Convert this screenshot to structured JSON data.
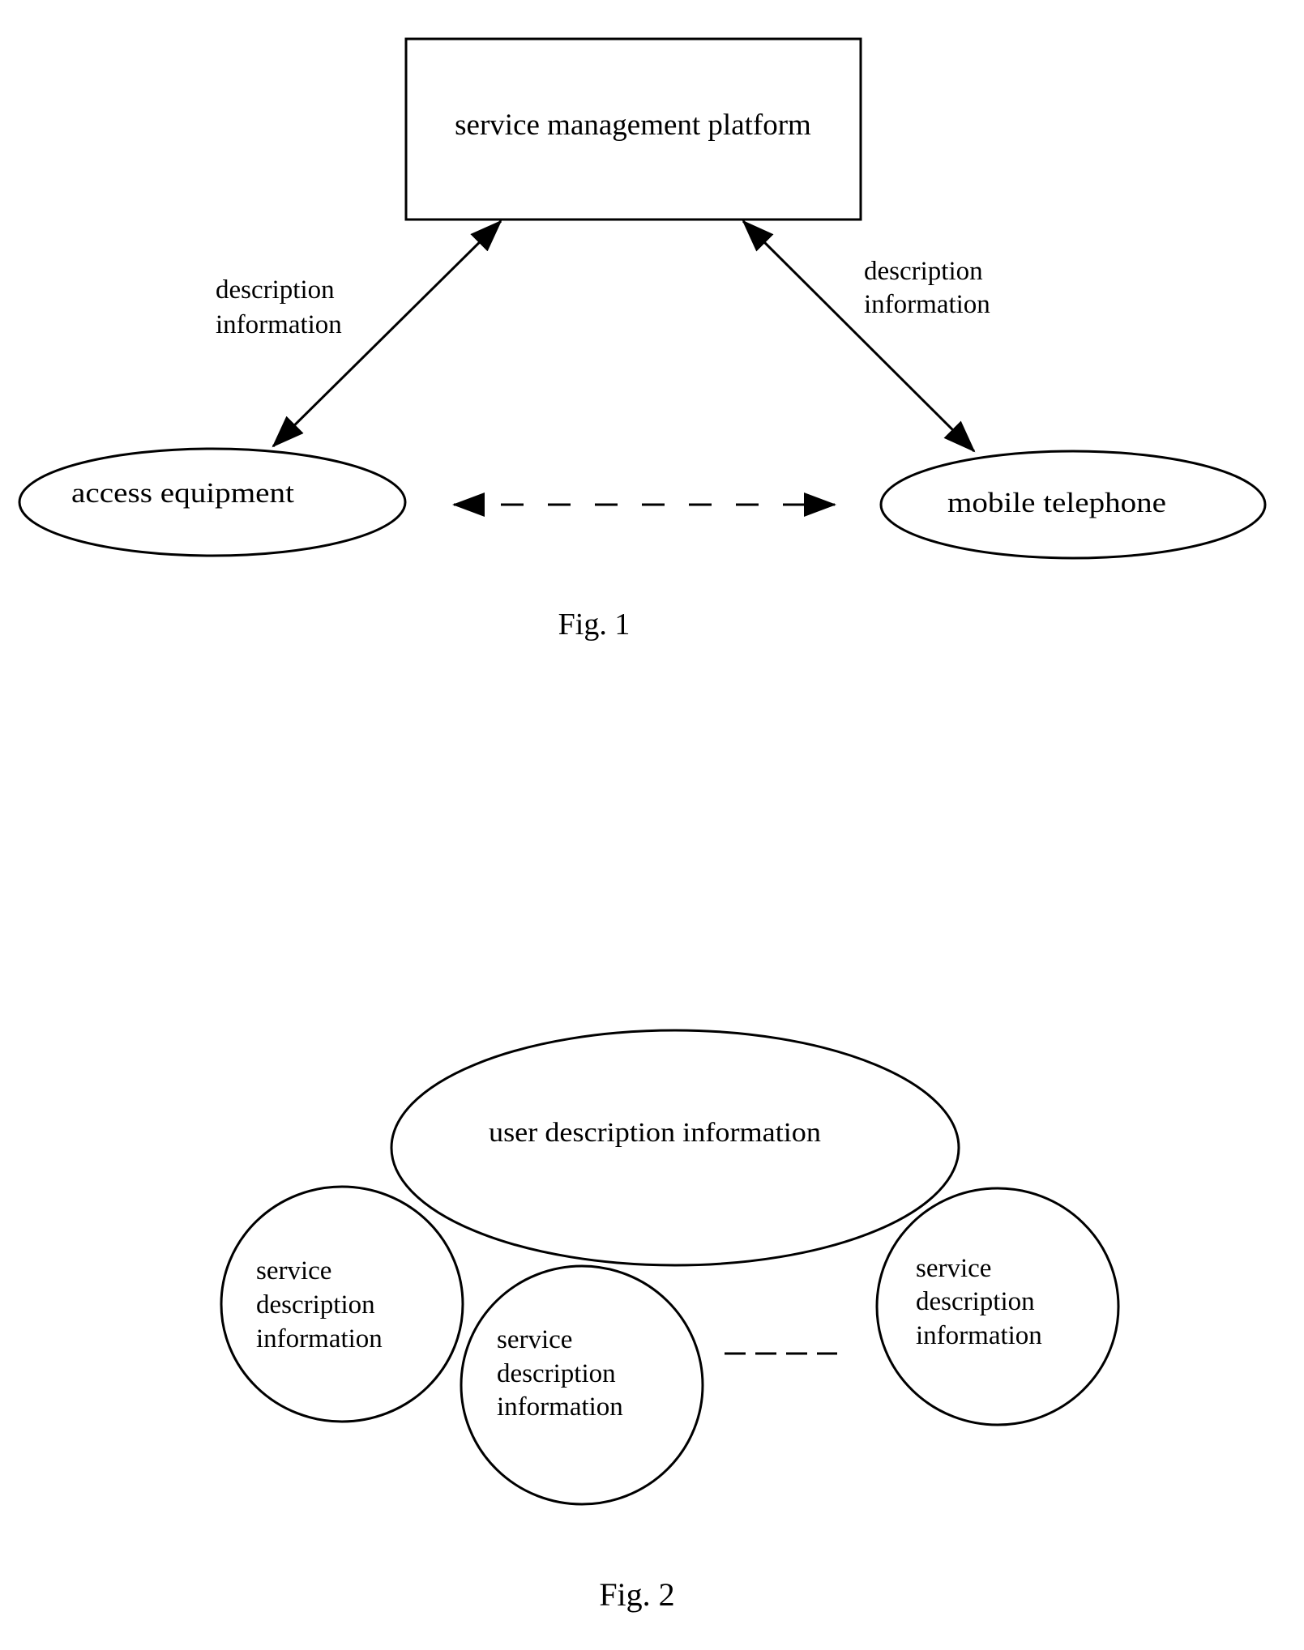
{
  "fig1": {
    "caption": "Fig. 1",
    "nodes": {
      "platform": "service management platform",
      "access": "access equipment",
      "mobile": "mobile telephone"
    },
    "edges": [
      {
        "from": "platform",
        "to": "access",
        "label_lines": [
          "description",
          "information"
        ],
        "style": "solid",
        "direction": "bidirectional"
      },
      {
        "from": "platform",
        "to": "mobile",
        "label_lines": [
          "description",
          "information"
        ],
        "style": "solid",
        "direction": "bidirectional"
      },
      {
        "from": "access",
        "to": "mobile",
        "label_lines": [],
        "style": "dashed",
        "direction": "bidirectional"
      }
    ]
  },
  "fig2": {
    "caption": "Fig. 2",
    "user_node": "user description information",
    "service_nodes": [
      [
        "service",
        "description",
        "information"
      ],
      [
        "service",
        "description",
        "information"
      ],
      [
        "service",
        "description",
        "information"
      ]
    ],
    "ellipsis": "- - - -"
  }
}
